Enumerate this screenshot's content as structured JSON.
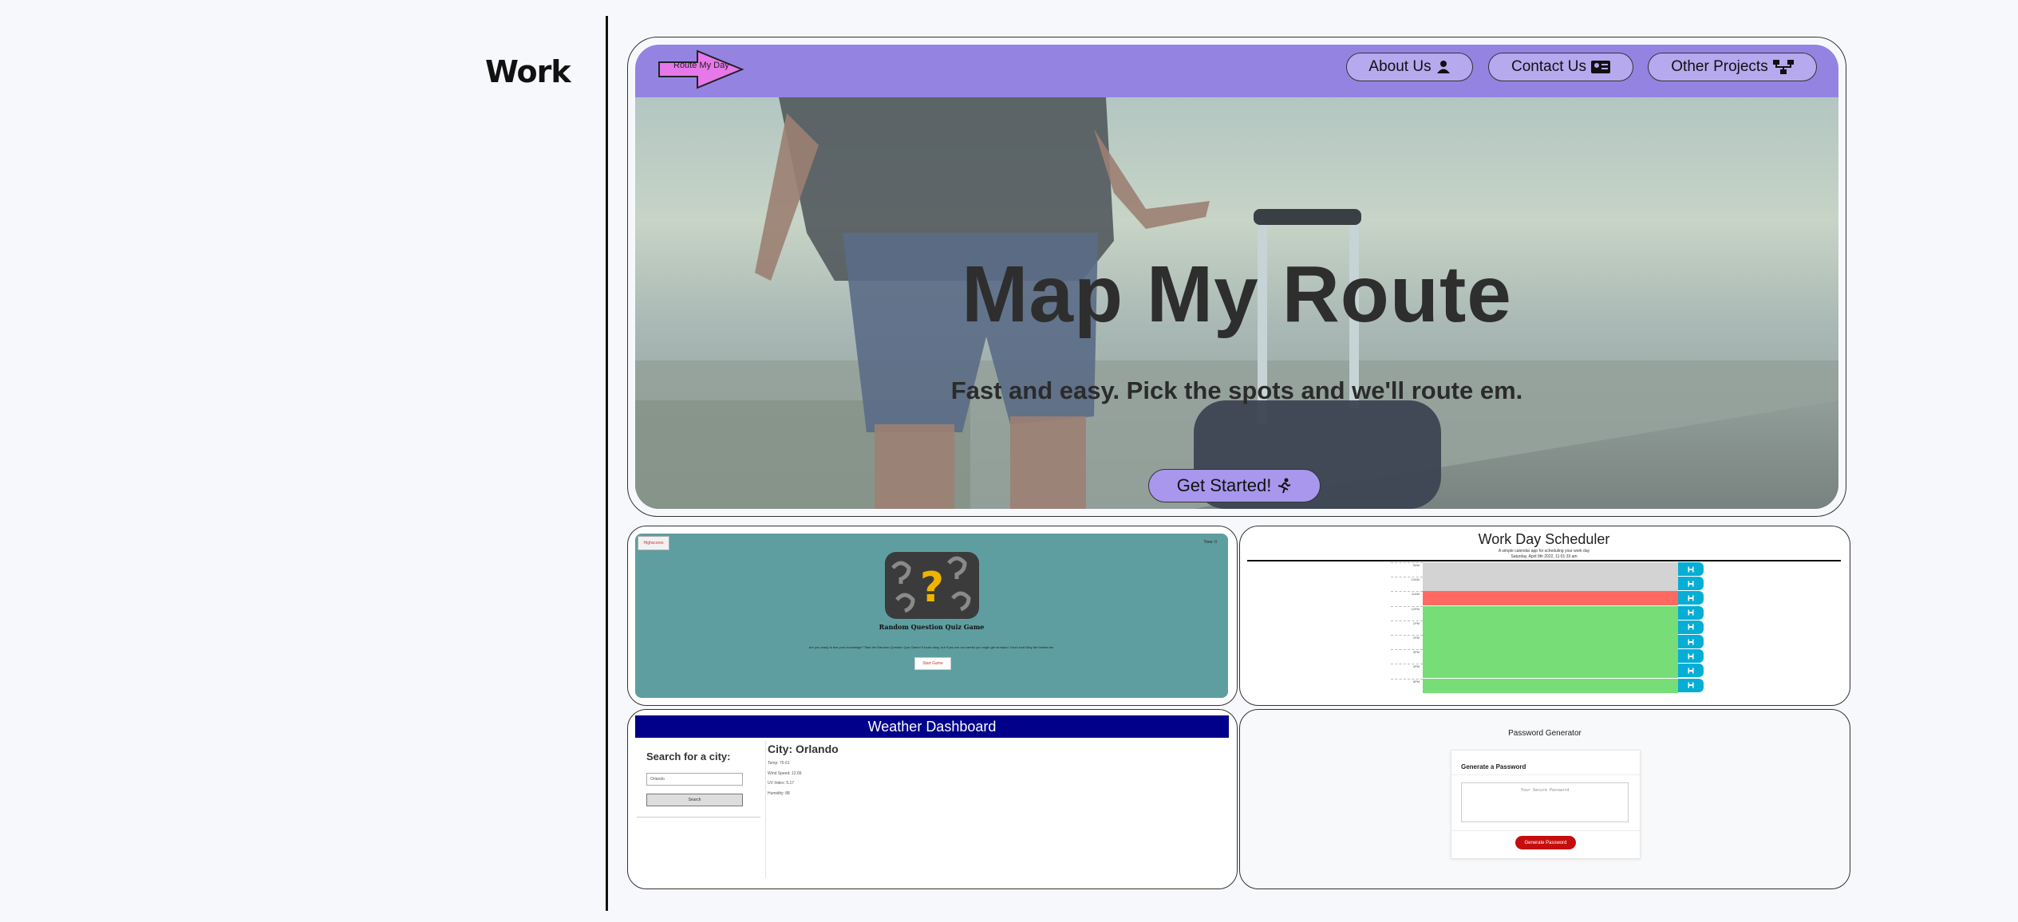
{
  "section": {
    "title": "Work"
  },
  "featured": {
    "logo_text": "Route My Day",
    "nav": [
      {
        "label": "About Us",
        "icon": "user-icon"
      },
      {
        "label": "Contact Us",
        "icon": "contact-card-icon"
      },
      {
        "label": "Other Projects",
        "icon": "sitemap-icon"
      }
    ],
    "hero_title": "Map My Route",
    "hero_subtitle": "Fast and easy. Pick the spots and we'll route em.",
    "cta_label": "Get Started!",
    "cta_icon": "running-person-icon"
  },
  "quiz": {
    "highscores_label": "Highscores",
    "time_label": "Time: 0",
    "title": "Random Question Quiz Game",
    "description": "Are you ready to test your knowledge? Take the Random Question Quiz Game! It looks easy, but if you are not careful you might get stumped. Good luck! May the fastest win.",
    "start_label": "Start Game"
  },
  "scheduler": {
    "title": "Work Day Scheduler",
    "subtitle": "A simple calendar app for scheduling your work day",
    "date": "Saturday, April 9th 2022, 11:01:33 am",
    "hours": [
      "9AM",
      "10AM",
      "11AM",
      "12PM",
      "1PM",
      "2PM",
      "3PM",
      "4PM",
      "5PM"
    ],
    "states": [
      "past",
      "past",
      "present",
      "future",
      "future",
      "future",
      "future",
      "future",
      "future"
    ],
    "colors": {
      "past": "#d3d3d3",
      "present": "#ff6961",
      "future": "#77dd77",
      "save": "#06aed5"
    }
  },
  "weather": {
    "title": "Weather Dashboard",
    "search_heading": "Search for a city:",
    "search_value": "Orlando",
    "search_button": "Search",
    "city_heading": "City: Orlando",
    "details": [
      "Temp: 75.61",
      "Wind Speed: 12.66",
      "UV Index: 5.17",
      "Humidity: 88"
    ],
    "header_color": "#00008b"
  },
  "password": {
    "title": "Password Generator",
    "card_heading": "Generate a Password",
    "placeholder": "Your Secure Password",
    "button_label": "Generate Password",
    "button_color": "#c50d0d"
  }
}
